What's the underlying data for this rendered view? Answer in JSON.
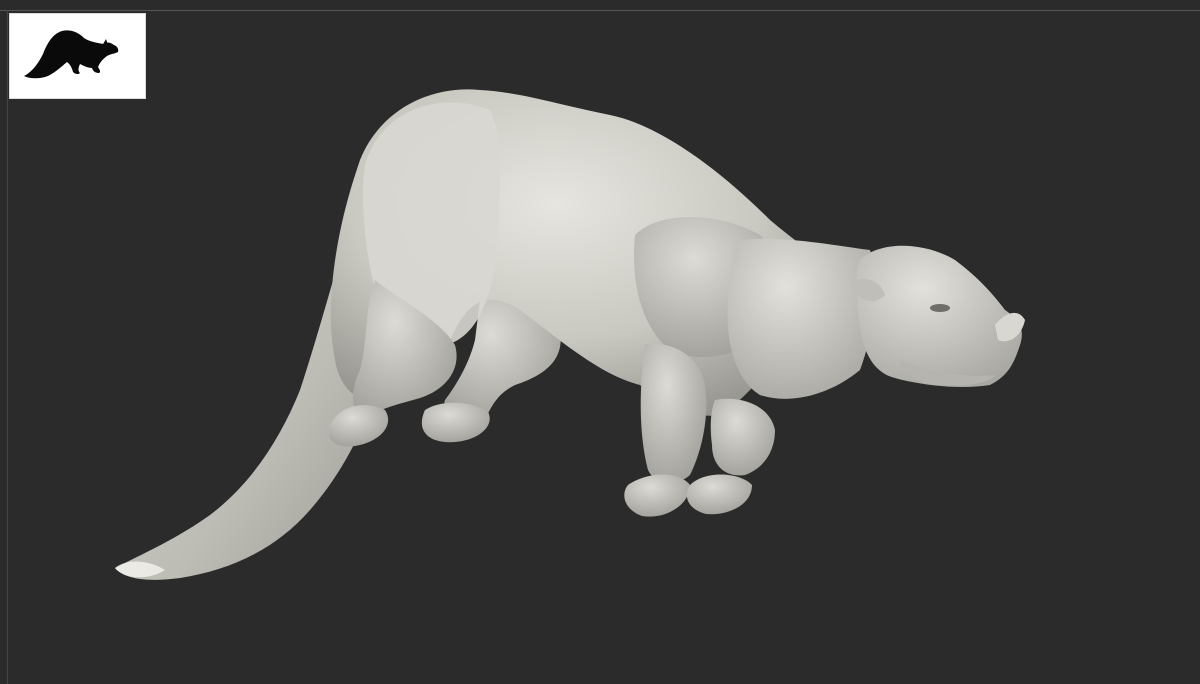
{
  "app": {
    "view": "3D viewport",
    "background_color": "#2b2b2b",
    "model_color": "#cfcec8"
  },
  "thumbnail": {
    "icon": "animal-silhouette-icon",
    "background_color": "#ffffff",
    "icon_color": "#0a0a0a"
  },
  "model": {
    "icon": "sculpted-creature-model"
  }
}
